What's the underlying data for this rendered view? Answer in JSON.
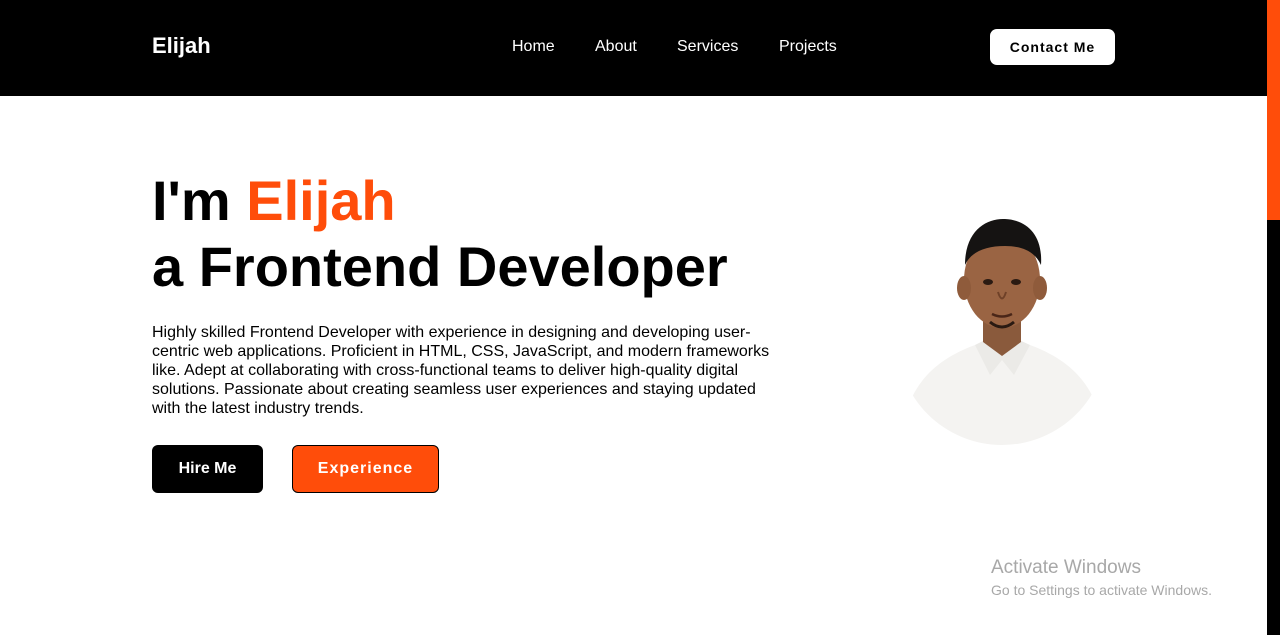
{
  "header": {
    "logo": "Elijah",
    "nav": [
      "Home",
      "About",
      "Services",
      "Projects"
    ],
    "contact_label": "Contact Me"
  },
  "hero": {
    "title_prefix": "I'm ",
    "title_name": "Elijah",
    "title_line2": "a Frontend Developer",
    "description": "Highly skilled Frontend Developer with experience in designing and developing user-centric web applications. Proficient in HTML, CSS, JavaScript, and modern frameworks like. Adept at collaborating with cross-functional teams to deliver high-quality digital solutions. Passionate about creating seamless user experiences and staying updated with the latest industry trends.",
    "hire_label": "Hire Me",
    "experience_label": "Experience"
  },
  "watermark": {
    "title": "Activate Windows",
    "subtitle": "Go to Settings to activate Windows."
  },
  "colors": {
    "accent": "#ff4d0a",
    "header_bg": "#000000"
  }
}
